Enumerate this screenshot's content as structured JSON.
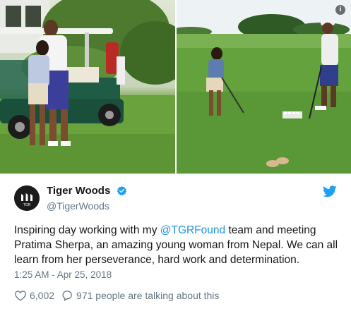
{
  "tweet": {
    "display_name": "Tiger Woods",
    "handle": "@TigerWoods",
    "text_before": "Inspiring day working with my ",
    "mention": "@TGRFound",
    "text_after": " team and meeting Pratima Sherpa, an amazing young woman from Nepal. We can all learn from her perseverance, hard work and determination.",
    "timestamp": "1:25 AM - Apr 25, 2018",
    "likes": "6,002",
    "talking": "971 people are talking about this",
    "avatar_text": "TGR"
  },
  "media": {
    "info_label": "i"
  },
  "icons": {
    "verified": "verified-badge-icon",
    "bird": "twitter-bird-icon",
    "like": "heart-icon",
    "reply": "speech-bubble-icon"
  },
  "colors": {
    "link": "#1b95e0",
    "verified": "#1da1f2",
    "muted": "#657786",
    "text": "#14171a"
  }
}
